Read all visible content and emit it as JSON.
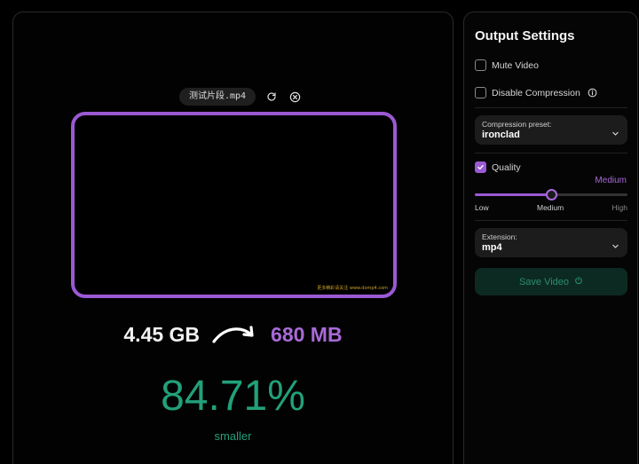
{
  "file": {
    "name": "测试片段.mp4"
  },
  "video": {
    "watermark": "更多精彩请关注 www.domp4.com"
  },
  "result": {
    "original_size": "4.45 GB",
    "compressed_size": "680 MB",
    "percent": "84.71%",
    "percent_label": "smaller"
  },
  "settings": {
    "title": "Output Settings",
    "mute_video": {
      "label": "Mute Video",
      "checked": false
    },
    "disable_compression": {
      "label": "Disable Compression",
      "checked": false
    },
    "compression_preset": {
      "label": "Compression preset:",
      "value": "ironclad"
    },
    "quality": {
      "label": "Quality",
      "checked": true,
      "current": "Medium",
      "level": 0.5,
      "labels": {
        "low": "Low",
        "medium": "Medium",
        "high": "High"
      }
    },
    "extension": {
      "label": "Extension:",
      "value": "mp4"
    },
    "save_label": "Save Video"
  },
  "colors": {
    "accent": "#9b59d3",
    "success": "#22a07a",
    "save_bg": "#0d2a22"
  }
}
